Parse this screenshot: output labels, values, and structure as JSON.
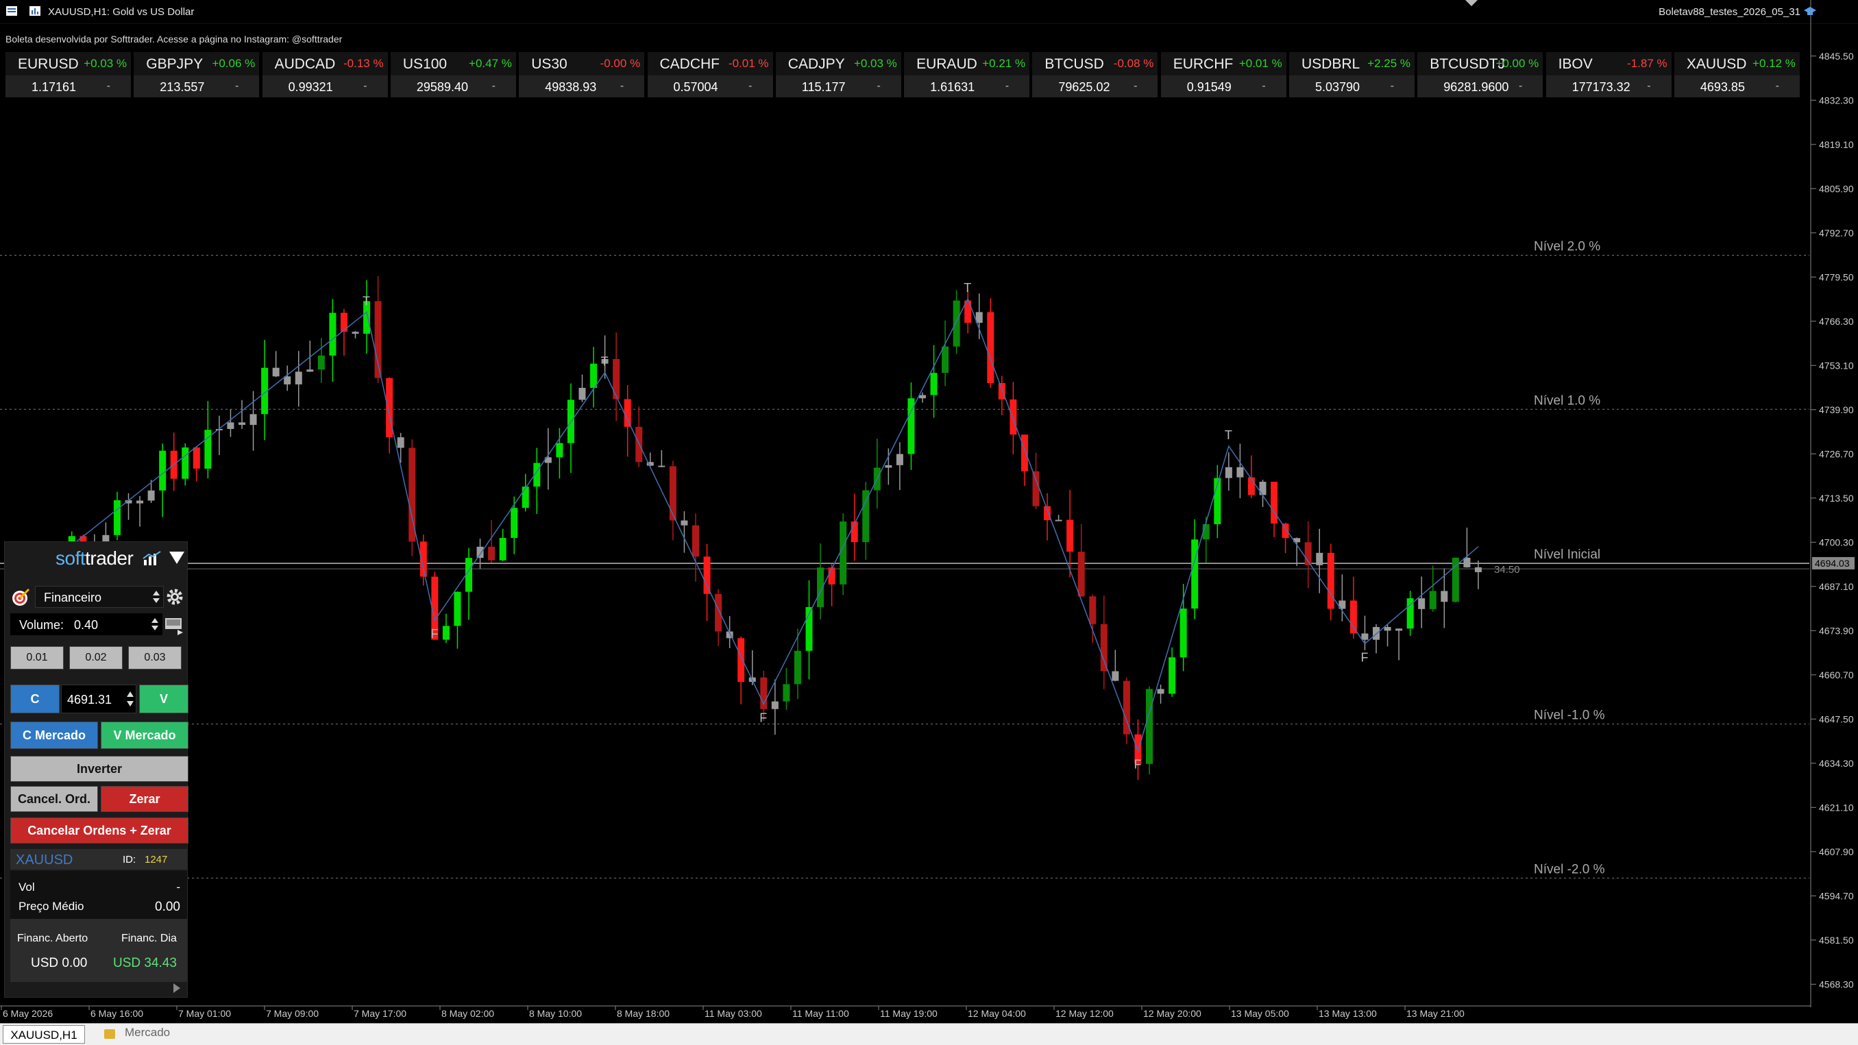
{
  "window": {
    "title": "XAUUSD,H1:  Gold vs US Dollar",
    "profile": "Boletav88_testes_2026_05_31"
  },
  "credit": "Boleta desenvolvida por Softtrader. Acesse a página no Instagram: @softtrader",
  "tickers": [
    {
      "symbol": "EURUSD",
      "change": "+0.03 %",
      "price": "1.17161",
      "sub": "-",
      "direction": "up"
    },
    {
      "symbol": "GBPJPY",
      "change": "+0.06 %",
      "price": "213.557",
      "sub": "-",
      "direction": "up"
    },
    {
      "symbol": "AUDCAD",
      "change": "-0.13 %",
      "price": "0.99321",
      "sub": "-",
      "direction": "down"
    },
    {
      "symbol": "US100",
      "change": "+0.47 %",
      "price": "29589.40",
      "sub": "-",
      "direction": "up"
    },
    {
      "symbol": "US30",
      "change": "-0.00 %",
      "price": "49838.93",
      "sub": "-",
      "direction": "down"
    },
    {
      "symbol": "CADCHF",
      "change": "-0.01 %",
      "price": "0.57004",
      "sub": "-",
      "direction": "down"
    },
    {
      "symbol": "CADJPY",
      "change": "+0.03 %",
      "price": "115.177",
      "sub": "-",
      "direction": "up"
    },
    {
      "symbol": "EURAUD",
      "change": "+0.21 %",
      "price": "1.61631",
      "sub": "-",
      "direction": "up"
    },
    {
      "symbol": "BTCUSD",
      "change": "-0.08 %",
      "price": "79625.02",
      "sub": "-",
      "direction": "down"
    },
    {
      "symbol": "EURCHF",
      "change": "+0.01 %",
      "price": "0.91549",
      "sub": "-",
      "direction": "up"
    },
    {
      "symbol": "USDBRL",
      "change": "+2.25 %",
      "price": "5.03790",
      "sub": "-",
      "direction": "up"
    },
    {
      "symbol": "BTCUSDTJ",
      "change": "+0.00 %",
      "price": "96281.9600",
      "sub": "-",
      "direction": "up"
    },
    {
      "symbol": "IBOV",
      "change": "-1.87 %",
      "price": "177173.32",
      "sub": "-",
      "direction": "down"
    },
    {
      "symbol": "XAUUSD",
      "change": "+0.12 %",
      "price": "4693.85",
      "sub": "-",
      "direction": "up"
    }
  ],
  "chart_data": {
    "type": "candlestick",
    "symbol": "XAUUSD",
    "timeframe": "H1",
    "ylim": [
      4561.0,
      4852.0
    ],
    "y_ticks": [
      "4845.50",
      "4832.30",
      "4819.10",
      "4805.90",
      "4792.70",
      "4779.50",
      "4766.30",
      "4753.10",
      "4739.90",
      "4726.70",
      "4713.50",
      "4700.30",
      "4687.10",
      "4673.90",
      "4660.70",
      "4647.50",
      "4634.30",
      "4621.10",
      "4607.90",
      "4594.70",
      "4581.50",
      "4568.30"
    ],
    "x_ticks": [
      "6 May 2026",
      "6 May 16:00",
      "7 May 01:00",
      "7 May 09:00",
      "7 May 17:00",
      "8 May 02:00",
      "8 May 10:00",
      "8 May 18:00",
      "11 May 03:00",
      "11 May 11:00",
      "11 May 19:00",
      "12 May 04:00",
      "12 May 12:00",
      "12 May 20:00",
      "13 May 05:00",
      "13 May 13:00",
      "13 May 21:00"
    ],
    "current_price": "4694.03",
    "spread_label": "34.50",
    "levels": [
      {
        "label": "Nível 2.0 %",
        "price": 4786.0
      },
      {
        "label": "Nível 1.0 %",
        "price": 4740.0
      },
      {
        "label": "Nível Inicial",
        "price": 4694.0
      },
      {
        "label": "Nível -1.0 %",
        "price": 4646.0
      },
      {
        "label": "Nível -2.0 %",
        "price": 4600.0
      }
    ],
    "zigzag": [
      {
        "candle": 0,
        "price": 4686,
        "label": ""
      },
      {
        "candle": 31,
        "price": 4769,
        "label": "T"
      },
      {
        "candle": 37,
        "price": 4677,
        "label": "F"
      },
      {
        "candle": 52,
        "price": 4751,
        "label": "T"
      },
      {
        "candle": 66,
        "price": 4652,
        "label": "F"
      },
      {
        "candle": 84,
        "price": 4773,
        "label": "T"
      },
      {
        "candle": 99,
        "price": 4638,
        "label": "F"
      },
      {
        "candle": 107,
        "price": 4729,
        "label": "T"
      },
      {
        "candle": 119,
        "price": 4670,
        "label": "F"
      },
      {
        "candle": 129,
        "price": 4699,
        "label": ""
      }
    ],
    "candles_generated_from_zigzag": true
  },
  "boleta": {
    "brand_soft": "soft",
    "brand_trader": "trader",
    "mode": "Financeiro",
    "volume_label": "Volume:",
    "volume": "0.40",
    "presets": [
      "0.01",
      "0.02",
      "0.03"
    ],
    "buy_label": "C",
    "sell_label": "V",
    "limit_price": "4691.31",
    "buy_market": "C Mercado",
    "sell_market": "V Mercado",
    "invert": "Inverter",
    "cancel_orders": "Cancel. Ord.",
    "zero": "Zerar",
    "cancel_zero": "Cancelar Ordens + Zerar",
    "symbol": "XAUUSD",
    "id_label": "ID:",
    "id": "1247",
    "vol_label": "Vol",
    "vol_value": "-",
    "avg_price_label": "Preço Médio",
    "avg_price": "0.00",
    "fin_open_label": "Financ. Aberto",
    "fin_day_label": "Financ. Dia",
    "fin_open": "USD 0.00",
    "fin_day": "USD 34.43"
  },
  "status": {
    "chart_tab": "XAUUSD,H1",
    "market_tab": "Mercado"
  },
  "colors": {
    "bull": "#00e000",
    "bull_dark": "#0a8a0a",
    "bear": "#ff1a1a",
    "bear_dark": "#b01818",
    "neutral": "#9a9a9a",
    "zigzag": "#3f6fae"
  }
}
